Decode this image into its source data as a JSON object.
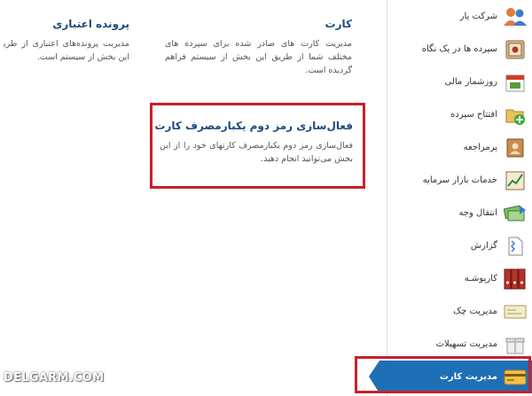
{
  "sidebar": {
    "items": [
      {
        "label": "شرکت یار",
        "icon": "users-icon"
      },
      {
        "label": "سپرده ها در یک نگاه",
        "icon": "safe-icon"
      },
      {
        "label": "روزشمار مالی",
        "icon": "calendar-icon"
      },
      {
        "label": "افتتاح سپرده",
        "icon": "add-folder-icon"
      },
      {
        "label": "پرمراجعه",
        "icon": "contact-card-icon"
      },
      {
        "label": "خدمات بازار سرمایه",
        "icon": "stock-chart-icon"
      },
      {
        "label": "انتقال وجه",
        "icon": "money-transfer-icon"
      },
      {
        "label": "گزارش",
        "icon": "report-icon"
      },
      {
        "label": "کارپوشـه",
        "icon": "binders-icon"
      },
      {
        "label": "مدیریت چک",
        "icon": "check-icon"
      },
      {
        "label": "مدیریت تسهیلات",
        "icon": "gift-box-icon"
      },
      {
        "label": "مدیریت کارت",
        "icon": "credit-card-icon"
      }
    ],
    "active_label": "مدیریت کارت"
  },
  "content": {
    "card": {
      "title": "کارت",
      "desc": "مدیریت کارت های صادر شده برای سپرده های مختلف شما از طریق این بخش از سیستم فراهم گردیده است."
    },
    "credit_file": {
      "title": "پرونده اعتباری",
      "desc": "مدیریت پرونده‌های اعتباری از طریق این بخش از سیستم است."
    },
    "otp": {
      "title": "فعال‌سازی رمز دوم یکبارمصرف کارت",
      "desc": "فعال‌سازی رمز دوم یکبارمصرف کارتهای خود را از این بخش می‌توانید انجام دهید."
    }
  },
  "watermark": "DELGARM.COM",
  "colors": {
    "accent": "#1f6fb7",
    "title": "#1d4a7e",
    "highlight": "#c8202a"
  }
}
